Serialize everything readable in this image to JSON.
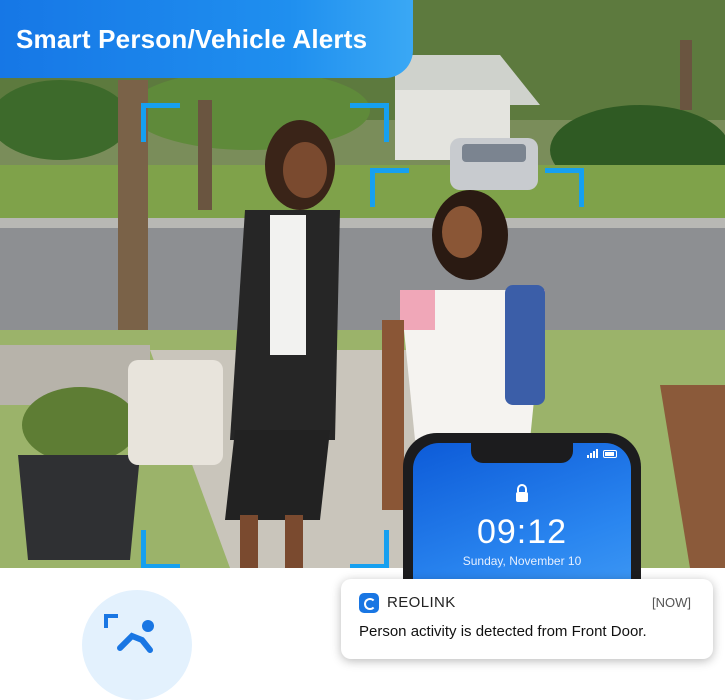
{
  "banner": {
    "title": "Smart Person/Vehicle Alerts"
  },
  "phone": {
    "time": "09:12",
    "date": "Sunday, November 10"
  },
  "notification": {
    "app_name": "REOLINK",
    "time": "[NOW]",
    "message": "Person activity is detected from Front Door."
  },
  "colors": {
    "accent": "#1677e6",
    "bracket": "#16a0f0"
  },
  "icons": [
    "lock-icon",
    "reolink-app-icon",
    "person-detection-icon"
  ]
}
